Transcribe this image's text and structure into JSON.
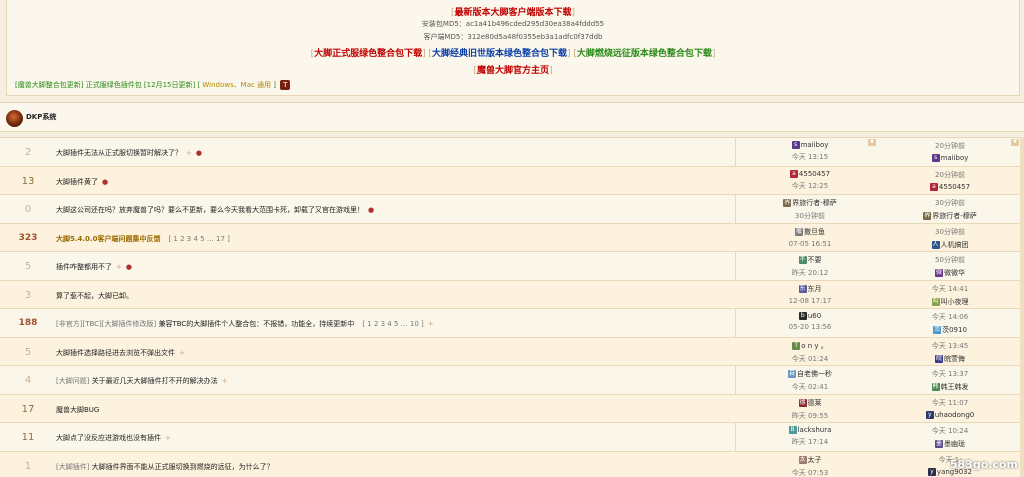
{
  "header": {
    "latest": "最新版本大脚客户端版本下载",
    "md5_install": "安装包MD5：ac1a41b496cded295d30ea38a4fddd55",
    "md5_client": "客户端MD5：312e80d5a48f0355eb3a1adfc0f37ddb",
    "dl_official": "大脚正式服绿色整合包下载",
    "dl_classic": "大脚经典旧世版本绿色整合包下载",
    "dl_burning": "大脚燃烧远征版本绿色整合包下载",
    "homepage": "魔兽大脚官方主页",
    "update_line_a": "[魔兽大脚整合包更新]",
    "update_line_b": "正式服绿色插件包 [12月15日更新] [",
    "update_line_c": "Windows、Mac 通用",
    "update_line_d": "]",
    "t_badge": "T"
  },
  "section": {
    "title": "DKP系统"
  },
  "colors": {
    "red": "#c00000",
    "blue": "#0d3fa8",
    "green": "#2a8a17",
    "accent": "#a0522d"
  },
  "threads": [
    {
      "count": "2",
      "title": "大脚插件无法从正式服切换暂时解决了？",
      "author": "maiiboy",
      "aicon": "s",
      "acolor": "#5b3a8a",
      "atime": "今天 13:15",
      "ltime": "20分钟前",
      "lname": "maiiboy",
      "licon": "s",
      "lcolor": "#5b3a8a",
      "marks": "+ ●"
    },
    {
      "count": "13",
      "title": "大脚插件黄了",
      "author": "4550457",
      "aicon": "a",
      "acolor": "#b3263a",
      "atime": "今天 12:25",
      "ltime": "20分钟前",
      "lname": "4550457",
      "licon": "a",
      "lcolor": "#b3263a",
      "marks": "●"
    },
    {
      "count": "0",
      "title": "大脚这公司还在吗？放弃魔兽了吗？要么不更新，要么今天我看大范围卡死，卸载了又官在游戏里！",
      "author": "界旅行者-穆萨",
      "aicon": "界",
      "acolor": "#7a6a4a",
      "atime": "30分钟前",
      "ltime": "30分钟前",
      "lname": "界旅行者-穆萨",
      "licon": "界",
      "lcolor": "#7a6a4a",
      "marks": "●"
    },
    {
      "count": "323",
      "title": "大脚5.4.0.0客户端问题集中反馈",
      "pages": "[ 1 2 3 4 5 … 17 ]",
      "author": "撒旦鱼",
      "aicon": "撒",
      "acolor": "#7a7a7a",
      "atime": "07-05 16:51",
      "ltime": "30分钟前",
      "lname": "人机搞团",
      "licon": "人",
      "lcolor": "#2d5a8a",
      "gold": true
    },
    {
      "count": "5",
      "title": "插件咋整都用不了",
      "author": "不要",
      "aicon": "不",
      "acolor": "#4a8a6a",
      "atime": "昨天 20:12",
      "ltime": "50分钟前",
      "lname": "微微华",
      "licon": "微",
      "lcolor": "#6a3a8a",
      "marks": "+ ●"
    },
    {
      "count": "3",
      "title": "算了惹不起，大脚已卸。",
      "author": "东月",
      "aicon": "东",
      "acolor": "#5a5aa0",
      "atime": "12-08 17:17",
      "ltime": "今天 14:41",
      "lname": "叫小夜理",
      "licon": "叫",
      "lcolor": "#8aa04a"
    },
    {
      "count": "188",
      "title": "兼容TBC的大脚插件个人整合包：不报错，功能全，持续更新中",
      "tag": "[非官方][TBC][大脚插件修改版]",
      "pages": "[ 1 2 3 4 5 … 10 ]",
      "author": "u60",
      "aicon": "b",
      "acolor": "#2a2a2a",
      "atime": "05-20 13:56",
      "ltime": "今天 14:06",
      "lname": "茨0910",
      "licon": "茨",
      "lcolor": "#4a9aca",
      "marks": "+"
    },
    {
      "count": "5",
      "title": "大脚插件选择路径进去浏览不弹出文件",
      "author": "o n y 。",
      "aicon": "T",
      "acolor": "#6a8a4a",
      "atime": "今天 01:24",
      "ltime": "今天 13:45",
      "lname": "皖萱侮",
      "licon": "皖",
      "lcolor": "#3a3a8a",
      "marks": "+"
    },
    {
      "count": "4",
      "title": "关于最近几天大脚插件打不开的解决办法",
      "tag": "[大脚问题]",
      "author": "自老佛一秒",
      "aicon": "自",
      "acolor": "#6a9ac0",
      "atime": "今天 02:41",
      "ltime": "今天 13:37",
      "lname": "韩王韩发",
      "licon": "韩",
      "lcolor": "#4a8a4a",
      "marks": "+"
    },
    {
      "count": "17",
      "title": "魔兽大脚BUG",
      "author": "德莱",
      "aicon": "德",
      "acolor": "#8a2a2a",
      "atime": "昨天 09:55",
      "ltime": "今天 11:07",
      "lname": "uhaodong0",
      "licon": "y",
      "lcolor": "#2a3a6a"
    },
    {
      "count": "11",
      "title": "大脚点了没反应进游戏也没有插件",
      "author": "lackshura",
      "aicon": "B",
      "acolor": "#4a9a9a",
      "atime": "昨天 17:14",
      "ltime": "今天 10:24",
      "lname": "墨幽珑",
      "licon": "墨",
      "lcolor": "#5a4a8a",
      "marks": "+"
    },
    {
      "count": "1",
      "title": "大脚插件界面不能从正式服切换到燃烧的远征，为什么了？",
      "tag": "[大脚插件]",
      "author": "太子",
      "aicon": "太",
      "acolor": "#9a7a6a",
      "atime": "今天 07:53",
      "ltime": "今天 1:",
      "lname": "yang9032",
      "licon": "y",
      "lcolor": "#2a2a4a"
    }
  ],
  "watermark": "583go.com"
}
